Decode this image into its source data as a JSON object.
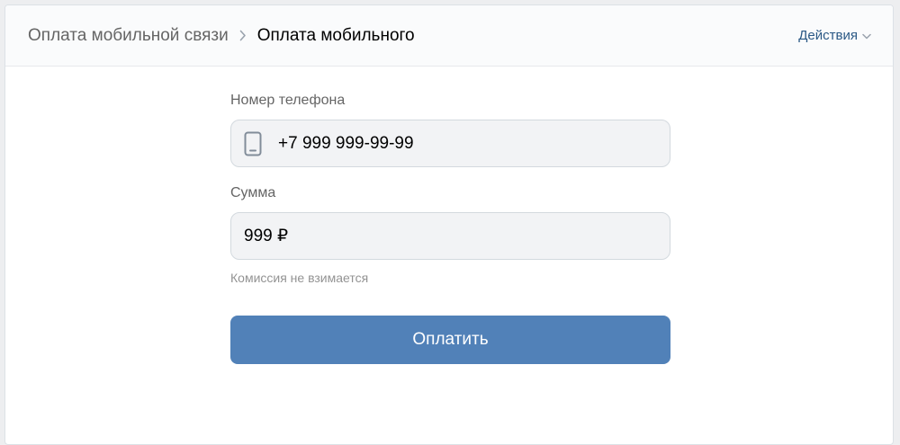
{
  "header": {
    "breadcrumb_parent": "Оплата мобильной связи",
    "breadcrumb_current": "Оплата мобильного",
    "actions_label": "Действия",
    "actions_icon": "chevron-down-icon",
    "separator_icon": "chevron-right-icon"
  },
  "form": {
    "phone": {
      "label": "Номер телефона",
      "value": "+7 999 999-99-99",
      "icon": "phone-icon"
    },
    "amount": {
      "label": "Сумма",
      "value": "999 ₽",
      "hint": "Комиссия не взимается"
    },
    "pay_button_label": "Оплатить"
  },
  "colors": {
    "accent": "#5181b8",
    "link": "#2a5885",
    "input_bg": "#f2f3f5",
    "page_bg": "#edeef0"
  }
}
